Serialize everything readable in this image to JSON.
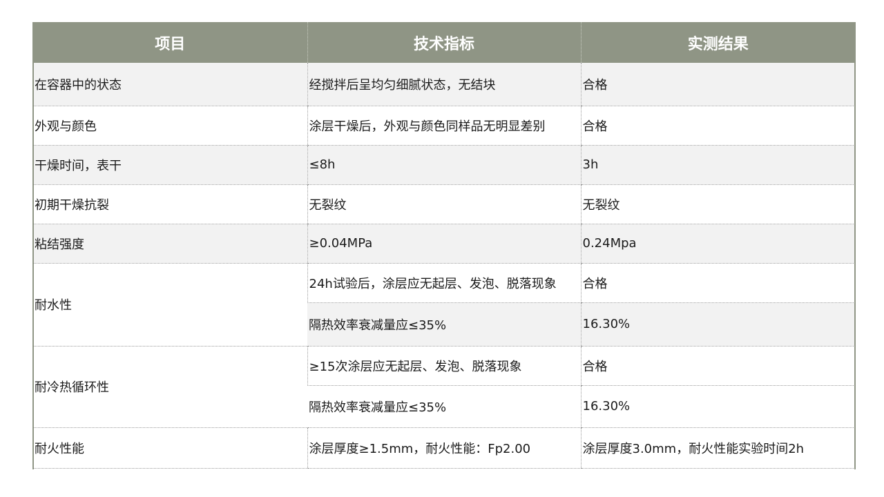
{
  "table": {
    "headers": [
      "项目",
      "技术指标",
      "实测结果"
    ],
    "rows": [
      {
        "item": "在容器中的状态",
        "spec": "经搅拌后呈均匀细腻状态，无结块",
        "result": "合格"
      },
      {
        "item": "外观与颜色",
        "spec": "涂层干燥后，外观与颜色同样品无明显差别",
        "result": "合格"
      },
      {
        "item": "干燥时间，表干",
        "spec": "≤8h",
        "result": "3h"
      },
      {
        "item": "初期干燥抗裂",
        "spec": "无裂纹",
        "result": "无裂纹"
      },
      {
        "item": "粘结强度",
        "spec": "≥0.04MPa",
        "result": "0.24Mpa"
      },
      {
        "item": "耐水性",
        "sub": [
          {
            "spec": "24h试验后，涂层应无起层、发泡、脱落现象",
            "result": "合格"
          },
          {
            "spec": "隔热效率衰减量应≤35%",
            "result": "16.30%"
          }
        ]
      },
      {
        "item": "耐冷热循环性",
        "sub": [
          {
            "spec": "≥15次涂层应无起层、发泡、脱落现象",
            "result": "合格"
          },
          {
            "spec": "隔热效率衰减量应≤35%",
            "result": "16.30%"
          }
        ]
      },
      {
        "item": "耐火性能",
        "spec": "涂层厚度≥1.5mm，耐火性能：Fp2.00",
        "result": "涂层厚度3.0mm，耐火性能实验时间2h"
      }
    ]
  }
}
